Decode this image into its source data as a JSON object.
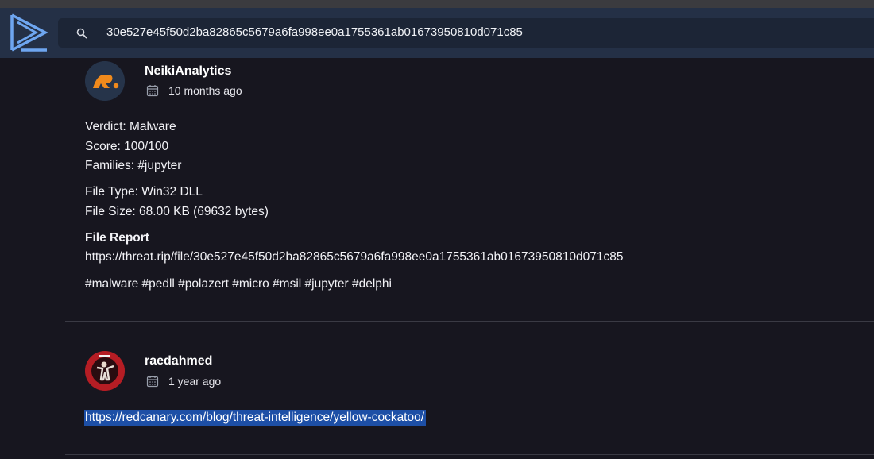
{
  "search": {
    "value": "30e527e45f50d2ba82865c5679a6fa998ee0a1755361ab01673950810d071c85"
  },
  "posts": [
    {
      "author": "NeikiAnalytics",
      "date": "10 months ago",
      "verdict": "Verdict: Malware",
      "score": "Score: 100/100",
      "families": "Families: #jupyter",
      "file_type": "File Type: Win32 DLL",
      "file_size": "File Size: 68.00 KB (69632 bytes)",
      "report_heading": "File Report",
      "report_url": "https://threat.rip/file/30e527e45f50d2ba82865c5679a6fa998ee0a1755361ab01673950810d071c85",
      "tags": "#malware #pedll #polazert #micro #msil #jupyter #delphi"
    },
    {
      "author": "raedahmed",
      "date": "1 year ago",
      "link": "https://redcanary.com/blog/threat-intelligence/yellow-cockatoo/"
    }
  ],
  "colors": {
    "header_bg": "#243046",
    "page_bg": "#17161f",
    "selection": "#1d4fa6",
    "logo": "#6ea6f0"
  }
}
